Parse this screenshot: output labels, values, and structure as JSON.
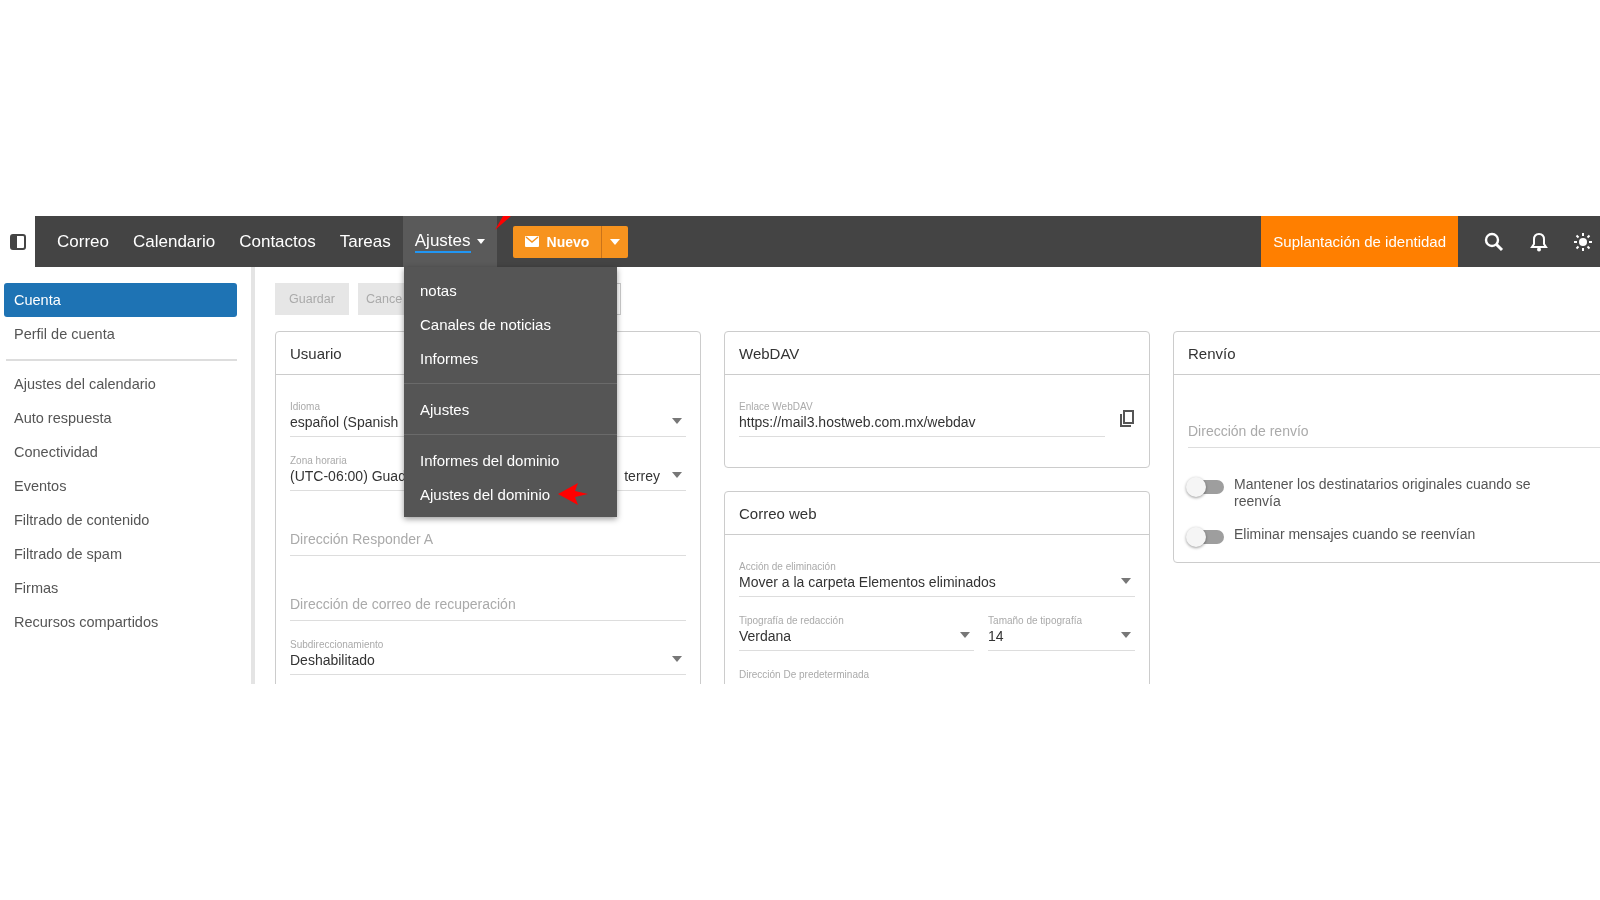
{
  "topbar": {
    "nav": [
      {
        "label": "Correo",
        "selected": false,
        "annotated": false
      },
      {
        "label": "Calendario",
        "selected": false,
        "annotated": false
      },
      {
        "label": "Contactos",
        "selected": false,
        "annotated": false
      },
      {
        "label": "Tareas",
        "selected": false,
        "annotated": false
      },
      {
        "label": "Ajustes",
        "selected": true,
        "annotated": true
      }
    ],
    "new_button": {
      "label": "Nuevo"
    },
    "impersonation_button": {
      "label": "Suplantación de identidad"
    }
  },
  "dropdown": {
    "groups": [
      [
        {
          "label": "notas",
          "annotated": false
        },
        {
          "label": "Canales de noticias",
          "annotated": false
        },
        {
          "label": "Informes",
          "annotated": false
        }
      ],
      [
        {
          "label": "Ajustes",
          "annotated": false
        }
      ],
      [
        {
          "label": "Informes del dominio",
          "annotated": false
        },
        {
          "label": "Ajustes del dominio",
          "annotated": true
        }
      ]
    ]
  },
  "sidebar": {
    "groups": [
      [
        {
          "label": "Cuenta",
          "selected": true
        },
        {
          "label": "Perfil de cuenta",
          "selected": false
        }
      ],
      [
        {
          "label": "Ajustes del calendario",
          "selected": false
        },
        {
          "label": "Auto respuesta",
          "selected": false
        },
        {
          "label": "Conectividad",
          "selected": false
        },
        {
          "label": "Eventos",
          "selected": false
        },
        {
          "label": "Filtrado de contenido",
          "selected": false
        },
        {
          "label": "Filtrado de spam",
          "selected": false
        },
        {
          "label": "Firmas",
          "selected": false
        },
        {
          "label": "Recursos compartidos",
          "selected": false
        }
      ]
    ]
  },
  "toolbar": {
    "buttons": [
      {
        "label": "Guardar",
        "disabled": true
      },
      {
        "label": "Cance",
        "disabled": true
      }
    ]
  },
  "columns": [
    [
      {
        "title": "Usuario",
        "fields": [
          {
            "kind": "select",
            "label": "Idioma",
            "value": "español (Spanish"
          },
          {
            "kind": "select",
            "label": "Zona horaria",
            "value": "(UTC-06:00) Guad",
            "value_end": "terrey"
          },
          {
            "kind": "input",
            "placeholder": "Dirección Responder A"
          },
          {
            "kind": "input",
            "placeholder": "Dirección de correo de recuperación"
          },
          {
            "kind": "select",
            "label": "Subdireccionamiento",
            "value": "Deshabilitado"
          }
        ]
      }
    ],
    [
      {
        "title": "WebDAV",
        "fields": [
          {
            "kind": "copy",
            "label": "Enlace WebDAV",
            "value": "https://mail3.hostweb.com.mx/webdav"
          }
        ]
      },
      {
        "title": "Correo web",
        "fields": [
          {
            "kind": "select",
            "label": "Acción de eliminación",
            "value": "Mover a la carpeta Elementos eliminados"
          },
          {
            "kind": "row",
            "fields": [
              {
                "kind": "select",
                "label": "Tipografía de redacción",
                "value": "Verdana"
              },
              {
                "kind": "select",
                "label": "Tamaño de tipografía",
                "value": "14"
              }
            ]
          },
          {
            "kind": "select",
            "label": "Dirección De predeterminada"
          }
        ]
      }
    ],
    [
      {
        "title": "Renvío",
        "fields": [
          {
            "kind": "input",
            "placeholder": "Dirección de renvío"
          },
          {
            "kind": "toggle",
            "label": "Mantener los destinatarios originales cuando se reenvía",
            "on": false
          },
          {
            "kind": "toggle",
            "label": "Eliminar mensajes cuando se reenvían",
            "on": false
          }
        ]
      }
    ]
  ]
}
